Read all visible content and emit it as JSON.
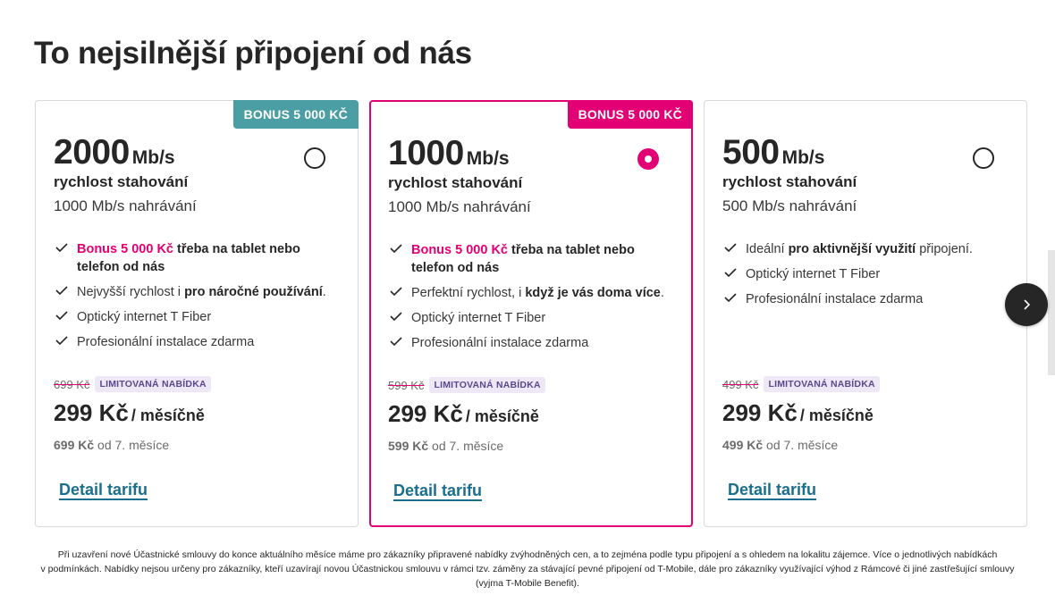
{
  "heading": "To nejsilnější připojení od nás",
  "cards": [
    {
      "bonus": "BONUS 5 000 KČ",
      "speed_value": "2000",
      "speed_unit": "Mb/s",
      "download_label": "rychlost stahování",
      "upload": "1000 Mb/s nahrávání",
      "selected": false,
      "features": [
        {
          "hl": "Bonus 5 000 Kč",
          "b": " třeba na tablet nebo telefon od nás"
        },
        {
          "t1": "Nejvyšší rychlost i ",
          "b": "pro náročné používání",
          "t2": "."
        },
        {
          "t1": "Optický internet T Fiber"
        },
        {
          "t1": "Profesionální instalace zdarma"
        }
      ],
      "old_price": "699 Kč",
      "badge": "LIMITOVANÁ NABÍDKA",
      "price": "299 Kč",
      "period": "/ měsíčně",
      "later_price": "699 Kč",
      "later_text": " od 7. měsíce",
      "detail": "Detail tarifu"
    },
    {
      "bonus": "BONUS 5 000 KČ",
      "speed_value": "1000",
      "speed_unit": "Mb/s",
      "download_label": "rychlost stahování",
      "upload": "1000 Mb/s nahrávání",
      "selected": true,
      "features": [
        {
          "hl": "Bonus 5 000 Kč",
          "b": " třeba na tablet nebo telefon od nás"
        },
        {
          "t1": "Perfektní rychlost, i ",
          "b": "když je vás doma více",
          "t2": "."
        },
        {
          "t1": "Optický internet T Fiber"
        },
        {
          "t1": "Profesionální instalace zdarma"
        }
      ],
      "old_price": "599 Kč",
      "badge": "LIMITOVANÁ NABÍDKA",
      "price": "299 Kč",
      "period": "/ měsíčně",
      "later_price": "599 Kč",
      "later_text": " od 7. měsíce",
      "detail": "Detail tarifu"
    },
    {
      "speed_value": "500",
      "speed_unit": "Mb/s",
      "download_label": "rychlost stahování",
      "upload": "500 Mb/s nahrávání",
      "selected": false,
      "features": [
        {
          "t1": "Ideální ",
          "b": "pro aktivnější využití",
          "t2": " připojení."
        },
        {
          "t1": "Optický internet T Fiber"
        },
        {
          "t1": "Profesionální instalace zdarma"
        }
      ],
      "old_price": "499 Kč",
      "badge": "LIMITOVANÁ NABÍDKA",
      "price": "299 Kč",
      "period": "/ měsíčně",
      "later_price": "499 Kč",
      "later_text": " od 7. měsíce",
      "detail": "Detail tarifu"
    }
  ],
  "carousel": {
    "next_icon": "chevron-right-icon"
  },
  "footnote": [
    "Při uzavření nové Účastnické smlouvy do konce aktuálního měsíce máme pro zákazníky připravené nabídky zvýhodněných cen, a to zejména podle typu připojení a s ohledem na lokalitu zájemce. Více o jednotlivých nabídkách",
    "v podmínkách. Nabídky nejsou určeny pro zákazníky, kteří uzavírají novou Účastnickou smlouvu v rámci tzv. záměny za stávající pevné připojení od T-Mobile, dále pro zákazníky využívající výhod z Rámcové či jiné zastřešující smlouvy",
    "(vyjma T-Mobile Benefit)."
  ],
  "colors": {
    "magenta": "#e20074",
    "teal": "#4c9ea5",
    "link": "#1a6e8e",
    "badge_bg": "#ede7f6"
  }
}
